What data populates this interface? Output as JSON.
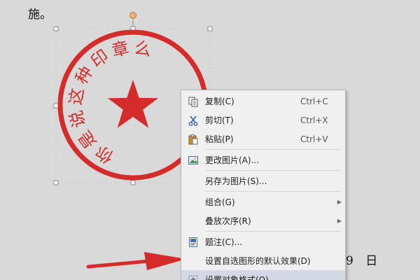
{
  "document": {
    "top_text": "施。",
    "date_text": "9 日"
  },
  "stamp": {
    "arc_chars": [
      "你",
      "是",
      "说",
      "这",
      "种",
      "印",
      "章",
      "么"
    ],
    "color": "#d42b2b"
  },
  "context_menu": {
    "items": [
      {
        "label": "复制(C)",
        "shortcut": "Ctrl+C",
        "icon": "copy-icon"
      },
      {
        "label": "剪切(T)",
        "shortcut": "Ctrl+X",
        "icon": "scissors-icon"
      },
      {
        "label": "粘贴(P)",
        "shortcut": "Ctrl+V",
        "icon": "paste-icon"
      },
      {
        "label": "更改图片(A)...",
        "shortcut": "",
        "icon": "change-picture-icon"
      },
      {
        "label": "另存为图片(S)...",
        "shortcut": "",
        "icon": ""
      },
      {
        "label": "组合(G)",
        "shortcut": "",
        "icon": "",
        "submenu": true
      },
      {
        "label": "叠放次序(R)",
        "shortcut": "",
        "icon": "",
        "submenu": true
      },
      {
        "label": "题注(C)...",
        "shortcut": "",
        "icon": "caption-icon"
      },
      {
        "label": "设置自选图形的默认效果(D)",
        "shortcut": "",
        "icon": ""
      },
      {
        "label": "设置对象格式(O)...",
        "shortcut": "",
        "icon": "format-object-icon",
        "highlighted": true
      }
    ]
  },
  "colors": {
    "annotation_arrow": "#d42b2b",
    "menu_highlight": "#d3d8e4"
  }
}
